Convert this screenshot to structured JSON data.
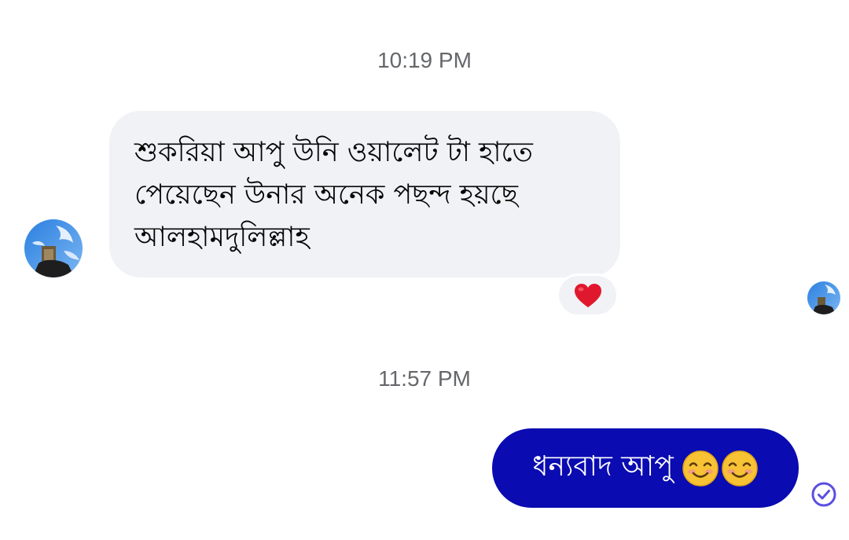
{
  "messages": [
    {
      "timestamp": "10:19 PM",
      "direction": "incoming",
      "text": "শুকরিয়া আপু উনি ওয়ালেট টা হাতে\nপেয়েছেন উনার অনেক পছন্দ হয়ছে\nআলহামদুলিল্লাহ",
      "reaction_icon": "red-heart-emoji"
    },
    {
      "timestamp": "11:57 PM",
      "direction": "outgoing",
      "text": "ধন্যবাদ আপু",
      "emoji_icons": [
        "smiling-face-emoji",
        "smiling-face-emoji"
      ],
      "status_icon": "sent-check-icon"
    }
  ],
  "colors": {
    "incoming_bubble": "#f0f2f5",
    "outgoing_bubble": "#0a0bb0",
    "timestamp_text": "#65676b",
    "status_check": "#5b4fe0",
    "heart": "#e0182d"
  }
}
